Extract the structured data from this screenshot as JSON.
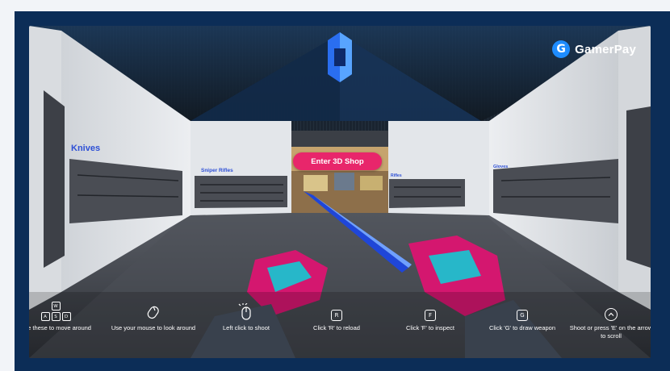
{
  "brand": {
    "name": "GamerPay",
    "badge_letter": "G",
    "badge_color": "#1e8cff"
  },
  "enter_button": {
    "label": "Enter 3D Shop",
    "color": "#e8266b"
  },
  "walls": {
    "knives": "Knives",
    "sniper": "Sniper Rifles",
    "rifles": "Rifles",
    "gloves": "Gloves"
  },
  "controls": {
    "move": {
      "keys": [
        "W",
        "A",
        "S",
        "D"
      ],
      "label": "Use these to move around"
    },
    "look": {
      "icon": "mouse-look-icon",
      "label": "Use your mouse to look around"
    },
    "shoot": {
      "icon": "mouse-click-icon",
      "label": "Left click to shoot"
    },
    "reload": {
      "key": "R",
      "label": "Click 'R' to reload"
    },
    "inspect": {
      "key": "F",
      "label": "Click 'F' to inspect"
    },
    "draw": {
      "key": "G",
      "label": "Click 'G' to draw weapon"
    },
    "scroll": {
      "icon": "chevron-up-icon",
      "label": "Shoot or press 'E' on the arrow to scroll"
    }
  },
  "colors": {
    "panel_bg": "#0c2d57",
    "label_blue": "#2d4fd6",
    "glove_pink": "#d4176f",
    "glove_cyan": "#27b7c9",
    "blade_blue": "#1f46d8"
  }
}
